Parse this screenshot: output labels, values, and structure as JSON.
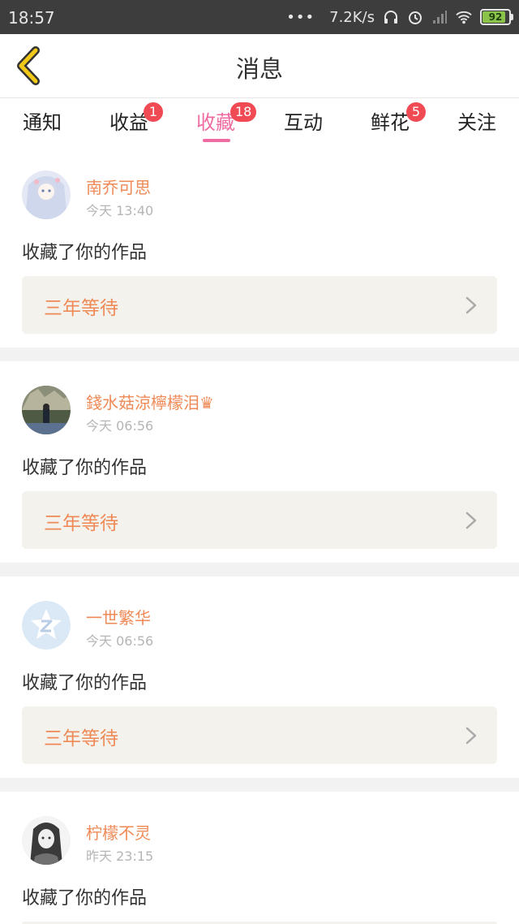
{
  "status_bar": {
    "time": "18:57",
    "dots": "•••",
    "network_speed": "7.2K/s",
    "battery": "92",
    "battery_percent": 92
  },
  "header": {
    "title": "消息"
  },
  "tabs": [
    {
      "label": "通知",
      "badge": "",
      "active": false
    },
    {
      "label": "收益",
      "badge": "1",
      "active": false
    },
    {
      "label": "收藏",
      "badge": "18",
      "active": true
    },
    {
      "label": "互动",
      "badge": "",
      "active": false
    },
    {
      "label": "鲜花",
      "badge": "5",
      "active": false
    },
    {
      "label": "关注",
      "badge": "",
      "active": false
    }
  ],
  "feed": [
    {
      "username": "南乔可思",
      "time": "今天 13:40",
      "action": "收藏了你的作品",
      "work_title": "三年等待"
    },
    {
      "username": "錢水菇涼檸檬泪♛",
      "time": "今天 06:56",
      "action": "收藏了你的作品",
      "work_title": "三年等待"
    },
    {
      "username": "一世繁华",
      "time": "今天 06:56",
      "action": "收藏了你的作品",
      "work_title": "三年等待"
    },
    {
      "username": "柠檬不灵",
      "time": "昨天 23:15",
      "action": "收藏了你的作品",
      "work_title": ""
    }
  ],
  "colors": {
    "accent_pink": "#f06ba1",
    "badge_red": "#f04a55",
    "username_orange": "#ef8a57",
    "back_arrow_yellow": "#f2c919",
    "work_card_bg": "#f3f2ed"
  }
}
